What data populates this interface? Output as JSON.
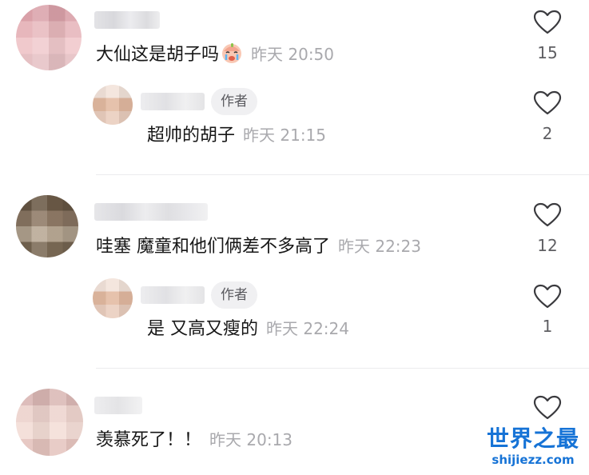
{
  "comments": [
    {
      "text": "大仙这是胡子吗",
      "time": "昨天 20:50",
      "likes": "15",
      "reply": {
        "badge": "作者",
        "text": "超帅的胡子",
        "time": "昨天 21:15",
        "likes": "2"
      }
    },
    {
      "text": "哇塞 魔童和他们俩差不多高了",
      "time": "昨天 22:23",
      "likes": "12",
      "reply": {
        "badge": "作者",
        "text": "是 又高又瘦的",
        "time": "昨天 22:24",
        "likes": "1"
      }
    },
    {
      "text": "羡慕死了！！",
      "time": "昨天 20:13",
      "likes": ""
    }
  ],
  "watermark": {
    "title": "世界之最",
    "domain": "shijiezz.com"
  },
  "colors": {
    "text": "#161616",
    "meta": "#a9a9ad",
    "badge_bg": "#f0f0f2",
    "watermark": "#1673d6"
  }
}
